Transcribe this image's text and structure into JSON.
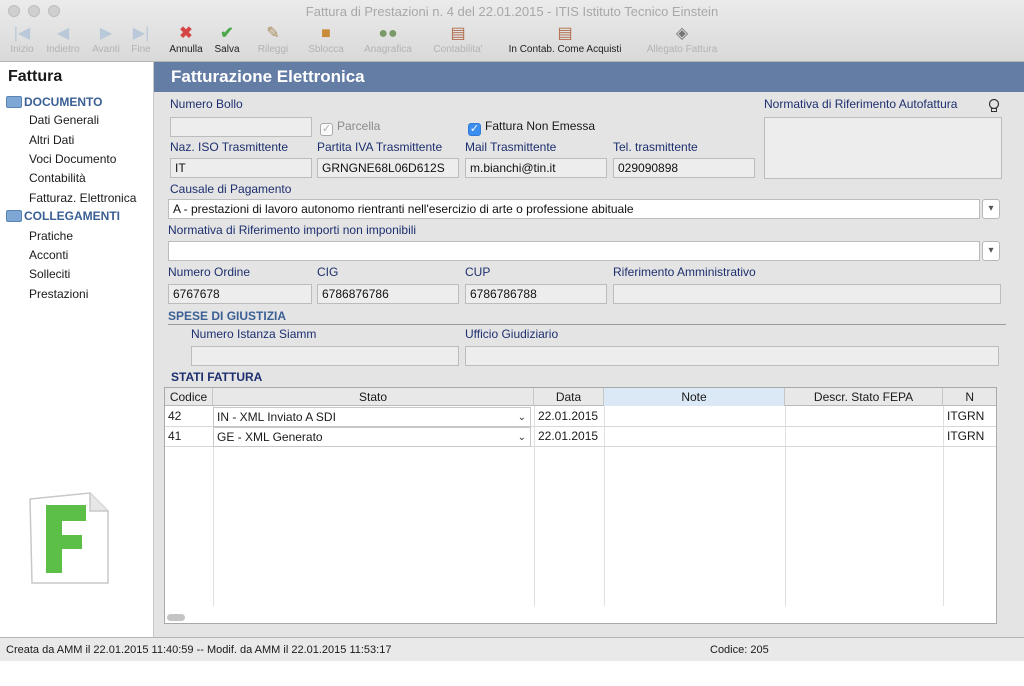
{
  "window": {
    "title": "Fattura di Prestazioni n. 4 del 22.01.2015 - ITIS Istituto Tecnico Einstein"
  },
  "toolbar": {
    "items": [
      {
        "label": "Inizio",
        "icon": "first-record-icon",
        "enabled": false
      },
      {
        "label": "Indietro",
        "icon": "previous-record-icon",
        "enabled": false
      },
      {
        "label": "Avanti",
        "icon": "next-record-icon",
        "enabled": false
      },
      {
        "label": "Fine",
        "icon": "last-record-icon",
        "enabled": false
      },
      {
        "label": "Annulla",
        "icon": "cancel-x-icon",
        "enabled": true
      },
      {
        "label": "Salva",
        "icon": "save-checkmark-icon",
        "enabled": true
      },
      {
        "label": "Rileggi",
        "icon": "brush-icon",
        "enabled": false
      },
      {
        "label": "Sblocca",
        "icon": "padlock-icon",
        "enabled": false
      },
      {
        "label": "Anagrafica",
        "icon": "people-icon",
        "enabled": false
      },
      {
        "label": "Contabilita'",
        "icon": "ledger-icon",
        "enabled": false
      },
      {
        "label": "In Contab. Come Acquisti",
        "icon": "ledger-icon",
        "enabled": true
      },
      {
        "label": "Allegato Fattura",
        "icon": "attachment-icon",
        "enabled": false
      }
    ]
  },
  "sidebar": {
    "title": "Fattura",
    "sections": [
      {
        "label": "DOCUMENTO",
        "items": [
          "Dati Generali",
          "Altri Dati",
          "Voci Documento",
          "Contabilità",
          "Fatturaz. Elettronica"
        ]
      },
      {
        "label": "COLLEGAMENTI",
        "items": [
          "Pratiche",
          "Acconti",
          "Solleciti",
          "Prestazioni"
        ]
      }
    ]
  },
  "main": {
    "header": "Fatturazione Elettronica",
    "numero_bollo": {
      "label": "Numero Bollo",
      "value": ""
    },
    "parcella": {
      "label": "Parcella",
      "checked": true,
      "enabled": false
    },
    "fattura_non_emessa": {
      "label": "Fattura Non Emessa",
      "checked": true
    },
    "normativa_autofattura": {
      "label": "Normativa di Riferimento Autofattura",
      "value": ""
    },
    "naz_iso": {
      "label": "Naz. ISO Trasmittente",
      "value": "IT"
    },
    "partita_iva": {
      "label": "Partita IVA Trasmittente",
      "value": "GRNGNE68L06D612S"
    },
    "mail": {
      "label": "Mail Trasmittente",
      "value": "m.bianchi@tin.it"
    },
    "tel": {
      "label": "Tel. trasmittente",
      "value": "029090898"
    },
    "causale": {
      "label": "Causale di Pagamento",
      "value": "A - prestazioni di lavoro autonomo rientranti nell'esercizio di arte o professione abituale"
    },
    "normativa_importi": {
      "label": "Normativa di Riferimento importi non imponibili",
      "value": ""
    },
    "numero_ordine": {
      "label": "Numero Ordine",
      "value": "6767678"
    },
    "cig": {
      "label": "CIG",
      "value": "6786876786"
    },
    "cup": {
      "label": "CUP",
      "value": "6786786788"
    },
    "rif_amministrativo": {
      "label": "Riferimento Amministrativo",
      "value": ""
    },
    "spese": {
      "title": "SPESE DI GIUSTIZIA",
      "numero_istanza": {
        "label": "Numero Istanza Siamm",
        "value": ""
      },
      "ufficio": {
        "label": "Ufficio Giudiziario",
        "value": ""
      }
    },
    "stati": {
      "title": "STATI FATTURA",
      "columns": [
        "Codice",
        "Stato",
        "Data",
        "Note",
        "Descr. Stato FEPA",
        "N"
      ],
      "rows": [
        {
          "codice": "42",
          "stato": "IN - XML Inviato A SDI",
          "data": "22.01.2015",
          "note": "",
          "descr": "",
          "n": "ITGRN"
        },
        {
          "codice": "41",
          "stato": "GE - XML Generato",
          "data": "22.01.2015",
          "note": "",
          "descr": "",
          "n": "ITGRN"
        }
      ]
    }
  },
  "status": {
    "left": "Creata da AMM il 22.01.2015 11:40:59 -- Modif. da AMM il 22.01.2015 11:53:17",
    "right": "Codice: 205"
  },
  "colors": {
    "header_bar": "#647da5",
    "label": "#1d2f6e",
    "accent": "#3b8ef0",
    "logo_green": "#5cbf48"
  }
}
